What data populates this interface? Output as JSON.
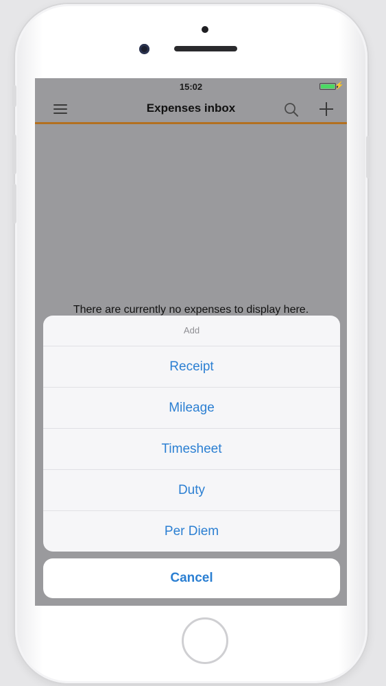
{
  "status_bar": {
    "time": "15:02",
    "battery_level": 1.0
  },
  "nav": {
    "title": "Expenses inbox",
    "icons": {
      "menu": "hamburger-menu-icon",
      "search": "search-icon",
      "add": "plus-icon"
    },
    "accent_color": "#b3701f"
  },
  "content": {
    "empty_message": "There are currently no expenses to display here."
  },
  "action_sheet": {
    "title": "Add",
    "items": [
      {
        "label": "Receipt"
      },
      {
        "label": "Mileage"
      },
      {
        "label": "Timesheet"
      },
      {
        "label": "Duty"
      },
      {
        "label": "Per Diem"
      }
    ],
    "cancel_label": "Cancel",
    "action_color": "#2b7fd2"
  }
}
